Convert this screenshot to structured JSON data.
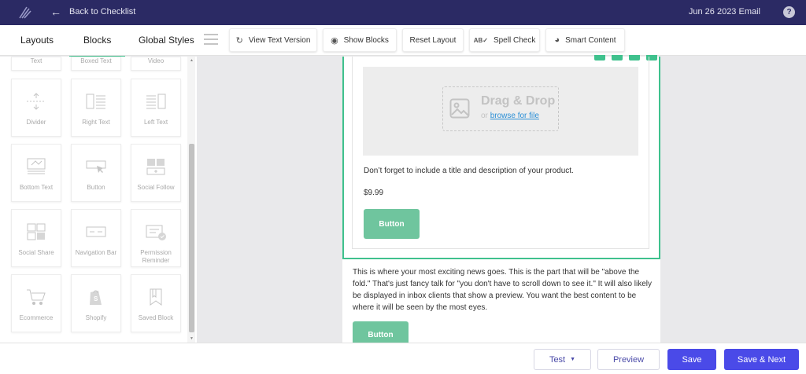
{
  "topbar": {
    "back_label": "Back to Checklist",
    "email_title": "Jun 26 2023 Email",
    "help_label": "?"
  },
  "tabs": [
    {
      "label": "Layouts"
    },
    {
      "label": "Blocks"
    },
    {
      "label": "Global Styles"
    }
  ],
  "active_tab": "Blocks",
  "toolbar": {
    "view_text": "View Text Version",
    "show_blocks": "Show Blocks",
    "reset_layout": "Reset Layout",
    "spell_check": "Spell Check",
    "smart_content": "Smart Content"
  },
  "blocks": {
    "top_partial": [
      "Text",
      "Boxed Text",
      "Video"
    ],
    "items": [
      "Divider",
      "Right Text",
      "Left Text",
      "Bottom Text",
      "Button",
      "Social Follow",
      "Social Share",
      "Navigation Bar",
      "Permission Reminder",
      "Ecommerce",
      "Shopify",
      "Saved Block"
    ]
  },
  "canvas": {
    "dropzone_title": "Drag & Drop",
    "dropzone_or": "or",
    "dropzone_link": "browse for file",
    "product_description": "Don’t forget to include a title and description of your product.",
    "price": "$9.99",
    "button_label": "Button",
    "news_text": "This is where your most exciting news goes. This is the part that will be \"above the fold.\" That's just fancy talk for \"you don't have to scroll down to see it.\" It will also likely be displayed in inbox clients that show a preview. You want the best content to be where it will be seen by the most eyes.",
    "button2_label": "Button"
  },
  "footer": {
    "test_label": "Test",
    "preview_label": "Preview",
    "save_label": "Save",
    "save_next_label": "Save & Next"
  },
  "colors": {
    "topbar": "#2b2a64",
    "accent_green": "#3fc18d",
    "button_green": "#6fc59e",
    "primary_blue": "#4a4ae8"
  }
}
